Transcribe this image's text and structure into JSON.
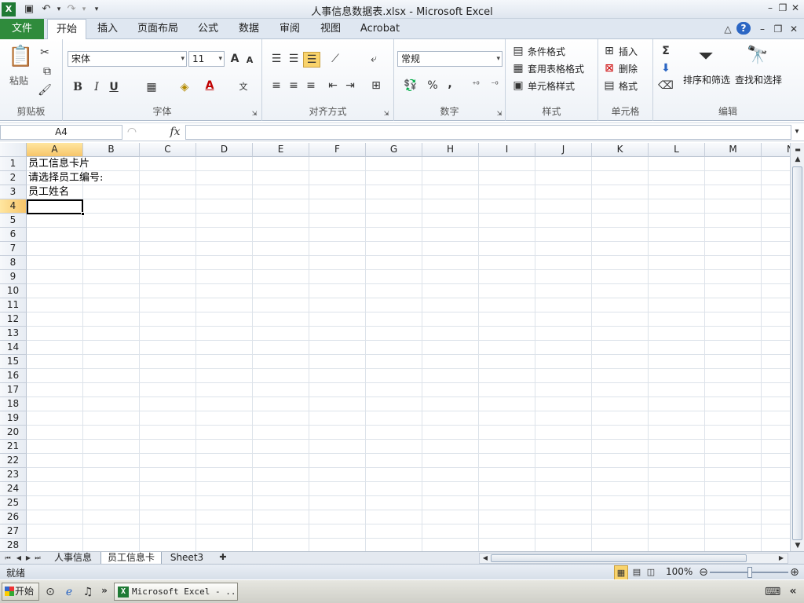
{
  "window": {
    "title": "人事信息数据表.xlsx - Microsoft Excel"
  },
  "qat": {
    "dropdown_glyph": "▾"
  },
  "ribbon_tabs": {
    "file": "文件",
    "items": [
      "开始",
      "插入",
      "页面布局",
      "公式",
      "数据",
      "审阅",
      "视图",
      "Acrobat"
    ]
  },
  "clipboard": {
    "paste": "粘贴",
    "group": "剪贴板"
  },
  "font": {
    "name": "宋体",
    "size": "11",
    "group": "字体",
    "bold": "B",
    "italic": "I",
    "underline": "U",
    "grow": "A",
    "shrink": "A",
    "color": "A"
  },
  "alignment": {
    "group": "对齐方式"
  },
  "number": {
    "format": "常规",
    "percent": "%",
    "comma": ",",
    "group": "数字"
  },
  "styles": {
    "conditional": "条件格式",
    "table": "套用表格格式",
    "cell": "单元格样式",
    "group": "样式"
  },
  "cells": {
    "insert": "插入",
    "delete": "删除",
    "format": "格式",
    "group": "单元格"
  },
  "editing": {
    "sum": "Σ",
    "sort": "排序和筛选",
    "find": "查找和选择",
    "group": "编辑"
  },
  "formula_bar": {
    "name_box": "A4",
    "fx": "fx"
  },
  "grid": {
    "columns": [
      "A",
      "B",
      "C",
      "D",
      "E",
      "F",
      "G",
      "H",
      "I",
      "J",
      "K",
      "L",
      "M",
      "N"
    ],
    "rows": [
      "1",
      "2",
      "3",
      "4",
      "5",
      "6",
      "7",
      "8",
      "9",
      "10",
      "11",
      "12",
      "13",
      "14",
      "15",
      "16",
      "17",
      "18",
      "19",
      "20",
      "21",
      "22",
      "23",
      "24",
      "25",
      "26",
      "27",
      "28"
    ],
    "cells": {
      "A1": "员工信息卡片",
      "A2": "请选择员工编号:",
      "A3": "员工姓名"
    },
    "active_cell": "A4"
  },
  "sheets": {
    "tabs": [
      "人事信息",
      "员工信息卡",
      "Sheet3"
    ],
    "active": "员工信息卡"
  },
  "status": {
    "ready": "就绪",
    "zoom": "100%"
  },
  "taskbar": {
    "start": "开始",
    "task": "Microsoft Excel - ..."
  },
  "colors": {
    "file_tab": "#2f8b3c",
    "selected_header": "#f7c56a"
  }
}
